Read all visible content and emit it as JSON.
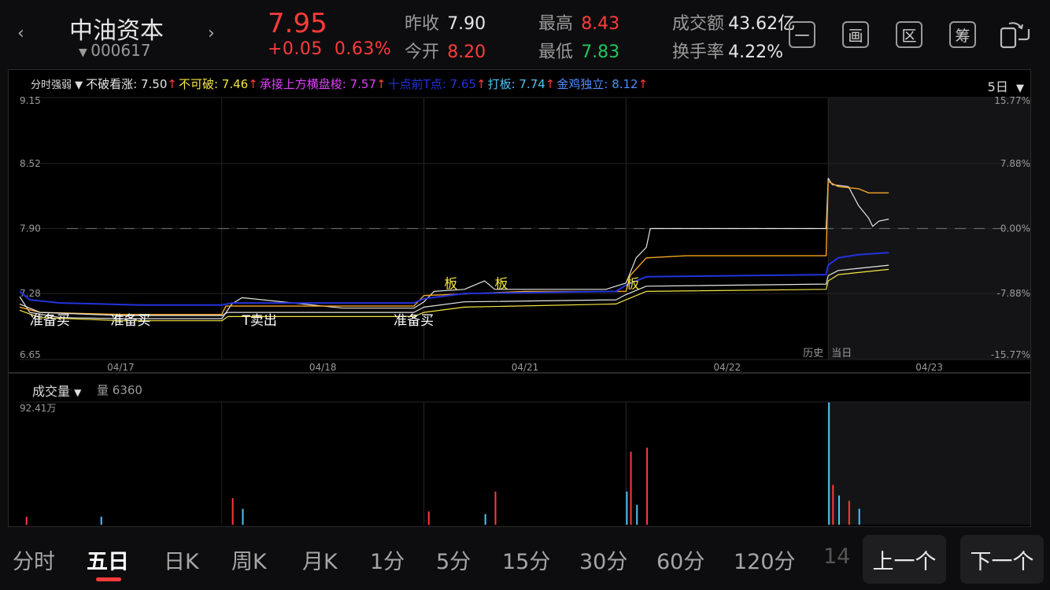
{
  "header": {
    "stock_name": "中油资本",
    "stock_code": "000617",
    "price": "7.95",
    "change": "+0.05",
    "change_pct": "0.63%",
    "quotes": [
      {
        "label": "昨收",
        "value": "7.90",
        "color": "white"
      },
      {
        "label": "今开",
        "value": "8.20",
        "color": "red"
      },
      {
        "label": "最高",
        "value": "8.43",
        "color": "red"
      },
      {
        "label": "最低",
        "value": "7.83",
        "color": "green"
      },
      {
        "label": "成交额",
        "value": "43.62亿",
        "color": "white"
      },
      {
        "label": "换手率",
        "value": "4.22%",
        "color": "white"
      }
    ],
    "tool_buttons": [
      "一",
      "画",
      "区",
      "筹"
    ]
  },
  "indicator_bar": {
    "selector": "分时强弱",
    "items": [
      {
        "text": "不破看涨: 7.50",
        "color": "#e6e6e6"
      },
      {
        "text": "不可破: 7.46",
        "color": "#f5e642"
      },
      {
        "text": "承接上方横盘梭: 7.57",
        "color": "#e040fb"
      },
      {
        "text": "十点前T点: 7.65",
        "color": "#2233dd"
      },
      {
        "text": "打板: 7.74",
        "color": "#4fc3f7"
      },
      {
        "text": "金鸡独立: 8.12",
        "color": "#4d8cff"
      }
    ],
    "arrow": "↑",
    "period": "5日"
  },
  "chart_data": {
    "type": "line",
    "y_left_ticks": [
      "9.15",
      "8.52",
      "7.90",
      "7.28",
      "6.65"
    ],
    "y_right_ticks": [
      "15.77%",
      "7.88%",
      "0.00%",
      "-7.88%",
      "-15.77%"
    ],
    "x_ticks": [
      "04/17",
      "04/18",
      "04/21",
      "04/22",
      "04/23"
    ],
    "ylim": [
      6.65,
      9.15
    ],
    "prev_close": 7.9,
    "history_label": "历史",
    "today_label": "当日",
    "annotations": [
      {
        "text": "准备买",
        "color": "#ffffff",
        "day": 0.05
      },
      {
        "text": "准备买",
        "color": "#ffffff",
        "day": 0.45
      },
      {
        "text": "T卖出",
        "color": "#ffffff",
        "day": 1.1
      },
      {
        "text": "准备买",
        "color": "#ffffff",
        "day": 1.85
      },
      {
        "text": "板",
        "color": "#f5e642",
        "day": 2.1
      },
      {
        "text": "板",
        "color": "#f5e642",
        "day": 2.35
      },
      {
        "text": "板",
        "color": "#f5e642",
        "day": 3.0
      }
    ],
    "series": [
      {
        "name": "price",
        "color": "#e6e6e6",
        "width": 1.2,
        "points": [
          [
            0,
            7.25
          ],
          [
            0.05,
            7.1
          ],
          [
            0.2,
            7.05
          ],
          [
            0.5,
            7.04
          ],
          [
            1,
            7.04
          ],
          [
            1.05,
            7.18
          ],
          [
            1.1,
            7.24
          ],
          [
            1.4,
            7.18
          ],
          [
            1.6,
            7.14
          ],
          [
            1.95,
            7.14
          ],
          [
            2,
            7.2
          ],
          [
            2.05,
            7.3
          ],
          [
            2.2,
            7.32
          ],
          [
            2.3,
            7.4
          ],
          [
            2.35,
            7.32
          ],
          [
            2.6,
            7.32
          ],
          [
            2.9,
            7.32
          ],
          [
            3.0,
            7.38
          ],
          [
            3.05,
            7.62
          ],
          [
            3.1,
            7.72
          ],
          [
            3.12,
            7.9
          ],
          [
            3.5,
            7.9
          ],
          [
            3.99,
            7.9
          ],
          [
            4,
            8.38
          ],
          [
            4.02,
            8.32
          ],
          [
            4.1,
            8.3
          ],
          [
            4.15,
            8.12
          ],
          [
            4.2,
            8.0
          ],
          [
            4.22,
            7.92
          ],
          [
            4.25,
            7.97
          ],
          [
            4.3,
            7.99
          ]
        ]
      },
      {
        "name": "jinji",
        "color": "#f5a623",
        "width": 1.4,
        "points": [
          [
            0,
            7.15
          ],
          [
            0.1,
            7.1
          ],
          [
            0.5,
            7.08
          ],
          [
            1,
            7.08
          ],
          [
            1.02,
            7.16
          ],
          [
            1.2,
            7.16
          ],
          [
            1.95,
            7.16
          ],
          [
            2,
            7.26
          ],
          [
            2.5,
            7.3
          ],
          [
            3,
            7.3
          ],
          [
            3.02,
            7.45
          ],
          [
            3.1,
            7.62
          ],
          [
            3.3,
            7.64
          ],
          [
            3.6,
            7.64
          ],
          [
            3.99,
            7.64
          ],
          [
            4,
            8.35
          ],
          [
            4.05,
            8.3
          ],
          [
            4.15,
            8.28
          ],
          [
            4.2,
            8.24
          ],
          [
            4.3,
            8.24
          ]
        ]
      },
      {
        "name": "shidian",
        "color": "#2233dd",
        "width": 2,
        "points": [
          [
            0,
            7.3
          ],
          [
            0.05,
            7.22
          ],
          [
            0.2,
            7.19
          ],
          [
            0.6,
            7.17
          ],
          [
            1,
            7.17
          ],
          [
            1.05,
            7.19
          ],
          [
            1.95,
            7.19
          ],
          [
            2.0,
            7.23
          ],
          [
            2.2,
            7.28
          ],
          [
            2.95,
            7.3
          ],
          [
            3.0,
            7.36
          ],
          [
            3.1,
            7.44
          ],
          [
            3.99,
            7.46
          ],
          [
            4.0,
            7.55
          ],
          [
            4.05,
            7.62
          ],
          [
            4.15,
            7.65
          ],
          [
            4.3,
            7.67
          ]
        ]
      },
      {
        "name": "bupokanzhang",
        "color": "#e6e6e6",
        "width": 1.2,
        "points": [
          [
            0,
            7.18
          ],
          [
            0.1,
            7.1
          ],
          [
            0.5,
            7.07
          ],
          [
            1,
            7.07
          ],
          [
            1.03,
            7.1
          ],
          [
            1.95,
            7.1
          ],
          [
            2.0,
            7.15
          ],
          [
            2.2,
            7.2
          ],
          [
            2.95,
            7.22
          ],
          [
            3.0,
            7.27
          ],
          [
            3.1,
            7.35
          ],
          [
            3.99,
            7.37
          ],
          [
            4.0,
            7.45
          ],
          [
            4.05,
            7.5
          ],
          [
            4.15,
            7.52
          ],
          [
            4.3,
            7.55
          ]
        ]
      },
      {
        "name": "bukepo",
        "color": "#f5e642",
        "width": 1.2,
        "points": [
          [
            0,
            7.12
          ],
          [
            0.1,
            7.05
          ],
          [
            0.5,
            7.02
          ],
          [
            1,
            7.02
          ],
          [
            1.03,
            7.06
          ],
          [
            1.95,
            7.06
          ],
          [
            2.0,
            7.1
          ],
          [
            2.2,
            7.15
          ],
          [
            2.95,
            7.18
          ],
          [
            3.0,
            7.22
          ],
          [
            3.1,
            7.3
          ],
          [
            3.99,
            7.32
          ],
          [
            4.0,
            7.4
          ],
          [
            4.05,
            7.46
          ],
          [
            4.15,
            7.48
          ],
          [
            4.3,
            7.51
          ]
        ]
      }
    ],
    "volume": {
      "label": "成交量",
      "amount_label": "量",
      "amount": "6360",
      "max_label": "92.41万",
      "max": 92.41,
      "spikes": [
        [
          0.03,
          6
        ],
        [
          0.4,
          6
        ],
        [
          1.05,
          20
        ],
        [
          1.1,
          12
        ],
        [
          2.02,
          10
        ],
        [
          2.3,
          8
        ],
        [
          2.35,
          25
        ],
        [
          3.0,
          25
        ],
        [
          3.02,
          55
        ],
        [
          3.05,
          15
        ],
        [
          3.1,
          58
        ],
        [
          4.0,
          92
        ],
        [
          4.02,
          30
        ],
        [
          4.05,
          22
        ],
        [
          4.1,
          18
        ],
        [
          4.15,
          12
        ]
      ]
    }
  },
  "bottom_nav": {
    "tabs": [
      "分时",
      "五日",
      "日K",
      "周K",
      "月K",
      "1分",
      "5分",
      "15分",
      "30分",
      "60分",
      "120分",
      "14"
    ],
    "active": "五日",
    "prev_button": "上一个",
    "next_button": "下一个"
  }
}
